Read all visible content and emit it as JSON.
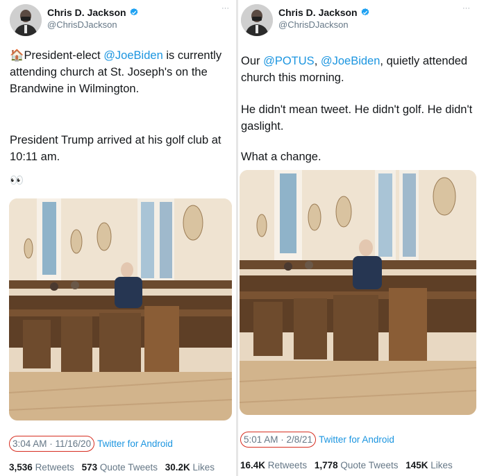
{
  "tweets": [
    {
      "author": {
        "name": "Chris D. Jackson",
        "handle": "@ChrisDJackson"
      },
      "text_parts": [
        {
          "text": "President-elect ",
          "type": "text"
        },
        {
          "text": "@JoeBiden",
          "type": "mention"
        },
        {
          "text": " is currently attending church at St. Joseph's on the Brandwine in Wilmington.",
          "type": "text"
        }
      ],
      "text_para2": "President Trump arrived at his golf club at 10:11 am.",
      "emoji": "👀",
      "timestamp": "3:04 AM · 11/16/20",
      "source": "Twitter for Android",
      "stats": {
        "retweets": {
          "value": "3,536",
          "label": "Retweets"
        },
        "quote_tweets": {
          "value": "573",
          "label": "Quote Tweets"
        },
        "likes": {
          "value": "30.2K",
          "label": "Likes"
        }
      }
    },
    {
      "author": {
        "name": "Chris D. Jackson",
        "handle": "@ChrisDJackson"
      },
      "line1_prefix": "Our ",
      "line1_mention1": "@POTUS",
      "line1_comma": ", ",
      "line1_mention2": "@JoeBiden",
      "line1_suffix": ", quietly attended church this morning.",
      "para2": "He didn't mean tweet. He didn't golf. He didn't gaslight.",
      "para3": "What a change.",
      "timestamp": "5:01 AM · 2/8/21",
      "source": "Twitter for Android",
      "stats": {
        "retweets": {
          "value": "16.4K",
          "label": "Retweets"
        },
        "quote_tweets": {
          "value": "1,778",
          "label": "Quote Tweets"
        },
        "likes": {
          "value": "145K",
          "label": "Likes"
        }
      }
    }
  ],
  "icons": {
    "house": "🏠",
    "more": "···",
    "verified_color": "#1da1f2",
    "annotation_color": "#d62d20"
  }
}
